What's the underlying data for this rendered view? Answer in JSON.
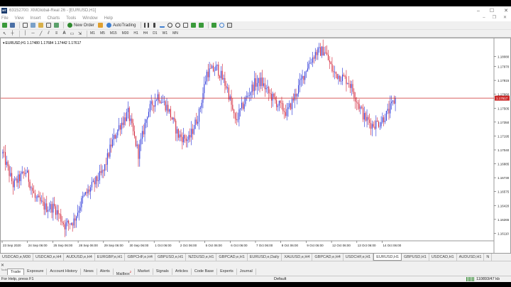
{
  "window": {
    "title": "63152700: XMGlobal-Real 26 - [EURUSD,H1]",
    "logo_text": "MT",
    "minimize": "–",
    "maximize": "☐",
    "close": "✕"
  },
  "menu": {
    "items": [
      "File",
      "View",
      "Insert",
      "Charts",
      "Tools",
      "Window",
      "Help"
    ],
    "doc_minimize": "–",
    "doc_restore": "❐",
    "doc_close": "✕"
  },
  "toolbar": {
    "new_order_label": "New Order",
    "autotrading_label": "AutoTrading",
    "timeframes": [
      "M1",
      "M5",
      "M15",
      "M30",
      "H1",
      "H4",
      "D1",
      "W1",
      "MN"
    ],
    "active_timeframe": "H1"
  },
  "chart": {
    "symbol_label": "EURUSD,H1  1.17480 1.17684 1.17442 1.17617",
    "current_price_label": "1.17617",
    "colors": {
      "bull": "#1f2bd6",
      "bear": "#d0182e",
      "wick": "#000000",
      "price_line": "#cc2a2a",
      "price_badge": "#cc2a2a"
    },
    "price_axis": [
      "1.18080",
      "1.17970",
      "1.17815",
      "1.17660",
      "1.17505",
      "1.17350",
      "1.17195",
      "1.17040",
      "1.16885",
      "1.16730",
      "1.16575",
      "1.16420",
      "1.16265",
      "1.16110"
    ],
    "time_axis": [
      "23 Sep 2020",
      "24 Sep 06:00",
      "25 Sep 06:00",
      "28 Sep 06:00",
      "29 Sep 06:00",
      "30 Sep 06:00",
      "1 Oct 06:00",
      "2 Oct 06:00",
      "5 Oct 06:00",
      "6 Oct 06:00",
      "7 Oct 06:00",
      "8 Oct 06:00",
      "9 Oct 06:00",
      "12 Oct 06:00",
      "13 Oct 06:00",
      "14 Oct 06:00"
    ]
  },
  "chart_data": {
    "type": "candlestick",
    "title": "EURUSD,H1  1.17480 1.17684 1.17442 1.17617",
    "xlabel": "",
    "ylabel": "",
    "ylim": [
      1.1605,
      1.1822
    ],
    "current_price": 1.17617,
    "x_ticks": [
      "23 Sep 2020",
      "24 Sep 06:00",
      "25 Sep 06:00",
      "28 Sep 06:00",
      "29 Sep 06:00",
      "30 Sep 06:00",
      "1 Oct 06:00",
      "2 Oct 06:00",
      "5 Oct 06:00",
      "6 Oct 06:00",
      "7 Oct 06:00",
      "8 Oct 06:00",
      "9 Oct 06:00",
      "12 Oct 06:00",
      "13 Oct 06:00",
      "14 Oct 06:00"
    ],
    "anchors": [
      [
        0,
        1.17
      ],
      [
        8,
        1.1665
      ],
      [
        18,
        1.168
      ],
      [
        25,
        1.165
      ],
      [
        33,
        1.164
      ],
      [
        40,
        1.164
      ],
      [
        48,
        1.162
      ],
      [
        55,
        1.1625
      ],
      [
        62,
        1.165
      ],
      [
        70,
        1.1665
      ],
      [
        78,
        1.168
      ],
      [
        84,
        1.171
      ],
      [
        90,
        1.173
      ],
      [
        97,
        1.1745
      ],
      [
        105,
        1.17
      ],
      [
        112,
        1.1745
      ],
      [
        120,
        1.1765
      ],
      [
        128,
        1.175
      ],
      [
        136,
        1.172
      ],
      [
        144,
        1.1715
      ],
      [
        152,
        1.1745
      ],
      [
        158,
        1.179
      ],
      [
        166,
        1.1795
      ],
      [
        174,
        1.1772
      ],
      [
        180,
        1.1735
      ],
      [
        188,
        1.176
      ],
      [
        195,
        1.1778
      ],
      [
        200,
        1.178
      ],
      [
        207,
        1.1765
      ],
      [
        213,
        1.1755
      ],
      [
        220,
        1.1745
      ],
      [
        228,
        1.177
      ],
      [
        235,
        1.1795
      ],
      [
        242,
        1.1812
      ],
      [
        249,
        1.1815
      ],
      [
        256,
        1.179
      ],
      [
        263,
        1.1785
      ],
      [
        268,
        1.178
      ],
      [
        274,
        1.176
      ],
      [
        280,
        1.174
      ],
      [
        286,
        1.1732
      ],
      [
        292,
        1.1735
      ],
      [
        298,
        1.1745
      ],
      [
        304,
        1.1761
      ]
    ]
  },
  "symbol_tabs": [
    "USDCAD,e,M30",
    "USDCAD,e,H4",
    "AUDUSD,e,H4",
    "EURGBP,e,H1",
    "GBPCHF,e,H4",
    "GBPUSD,e,H1",
    "NZDUSD,e,H1",
    "GBPCAD,e,H1",
    "EURUSD,e,Daily",
    "XAUUSD,e,H4",
    "GBPCAD,e,H4",
    "USDCHF,e,H1",
    "EURUSD,H1",
    "GBPUSD,H1",
    "USDCAD,H1",
    "AUDUSD,H1",
    "N"
  ],
  "active_symbol_tab": "EURUSD,H1",
  "terminal": {
    "close": "✕",
    "label": "Toolbox",
    "tabs": [
      "Trade",
      "Exposure",
      "Account History",
      "News",
      "Alerts",
      "Mailbox",
      "Market",
      "Signals",
      "Articles",
      "Code Base",
      "Experts",
      "Journal"
    ],
    "active_tab": "Trade",
    "mailbox_badge": "2"
  },
  "status": {
    "help": "For Help, press F1",
    "profile": "Default",
    "connection": "110893/47 kb"
  }
}
